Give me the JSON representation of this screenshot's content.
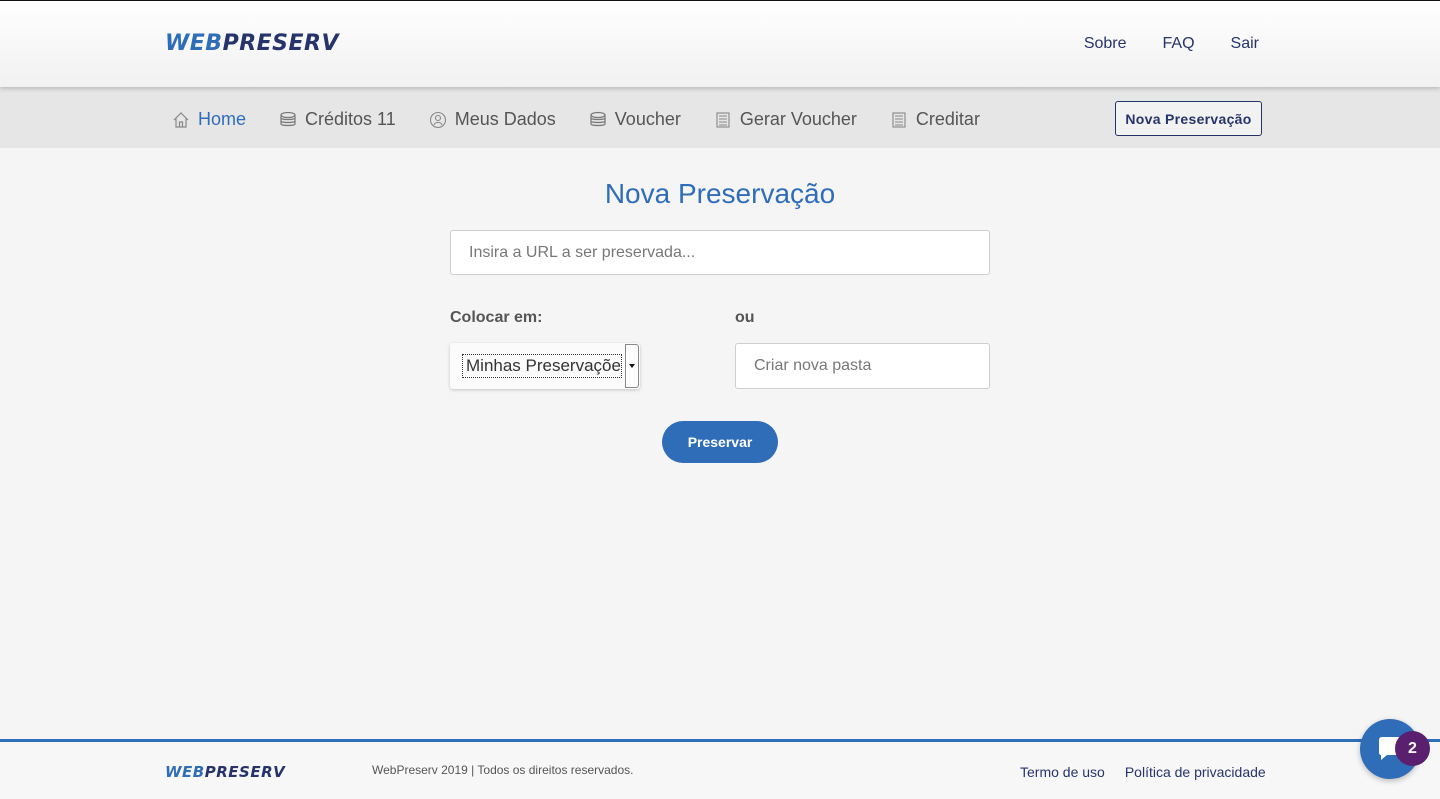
{
  "header": {
    "logo_web": "WEB",
    "logo_preserv": "PRESERV",
    "links": [
      "Sobre",
      "FAQ",
      "Sair"
    ]
  },
  "nav": {
    "items": [
      {
        "label": "Home",
        "icon": "home-icon",
        "active": true
      },
      {
        "label": "Créditos 11",
        "icon": "coins-icon",
        "active": false
      },
      {
        "label": "Meus Dados",
        "icon": "user-icon",
        "active": false
      },
      {
        "label": "Voucher",
        "icon": "coins-icon",
        "active": false
      },
      {
        "label": "Gerar Voucher",
        "icon": "register-icon",
        "active": false
      },
      {
        "label": "Creditar",
        "icon": "register-icon",
        "active": false
      }
    ],
    "new_button": "Nova Preservação"
  },
  "main": {
    "title": "Nova Preservação",
    "url_placeholder": "Insira a URL a ser preservada...",
    "place_label": "Colocar em:",
    "or_label": "ou",
    "select_value": "Minhas Preservações",
    "folder_placeholder": "Criar nova pasta",
    "submit_label": "Preservar"
  },
  "footer": {
    "logo_web": "WEB",
    "logo_preserv": "PRESERV",
    "copyright": "WebPreserv 2019 | Todos os direitos reservados.",
    "links": [
      "Termo de uso",
      "Política de privacidade"
    ]
  },
  "chat": {
    "badge_count": "2"
  },
  "colors": {
    "primary": "#2f6db8",
    "dark_navy": "#26346b",
    "badge": "#5b1f6f"
  }
}
